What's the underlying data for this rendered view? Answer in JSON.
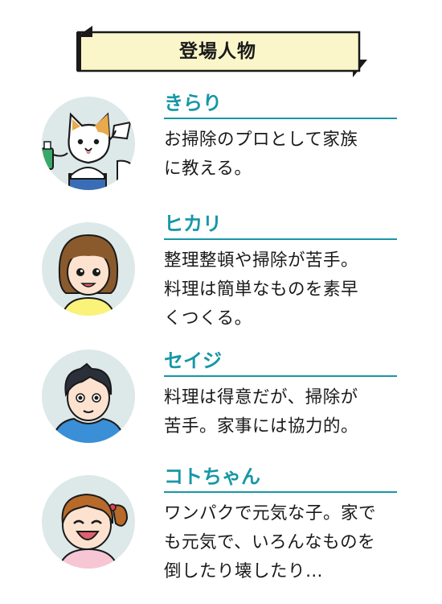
{
  "header": {
    "title": "登場人物"
  },
  "colors": {
    "accent": "#1797a6",
    "banner_bg": "#fbf6c9",
    "avatar_bg": "#dde8e8"
  },
  "characters": [
    {
      "name": "きらり",
      "desc": "お掃除のプロとして家族\nに教える。",
      "avatar": "cat-with-spray-bottle-icon"
    },
    {
      "name": "ヒカリ",
      "desc": "整理整頓や掃除が苦手。\n料理は簡単なものを素早\nくつくる。",
      "avatar": "woman-with-bob-hair-icon"
    },
    {
      "name": "セイジ",
      "desc": "料理は得意だが、掃除が\n苦手。家事には協力的。",
      "avatar": "man-in-blue-hoodie-icon"
    },
    {
      "name": "コトちゃん",
      "desc": "ワンパクで元気な子。家で\nも元気で、いろんなものを\n倒したり壊したり…",
      "avatar": "laughing-girl-with-ponytail-icon"
    }
  ]
}
